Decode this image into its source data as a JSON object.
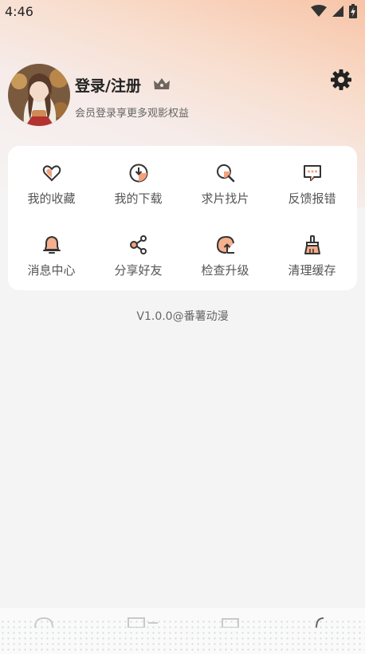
{
  "status_bar": {
    "time": "4:46"
  },
  "profile": {
    "login_label": "登录/注册",
    "subtitle": "会员登录享更多观影权益"
  },
  "menu": [
    {
      "label": "我的收藏",
      "icon": "heart-icon"
    },
    {
      "label": "我的下载",
      "icon": "download-icon"
    },
    {
      "label": "求片找片",
      "icon": "search-icon"
    },
    {
      "label": "反馈报错",
      "icon": "feedback-icon"
    },
    {
      "label": "消息中心",
      "icon": "bell-icon"
    },
    {
      "label": "分享好友",
      "icon": "share-icon"
    },
    {
      "label": "检查升级",
      "icon": "upgrade-icon"
    },
    {
      "label": "清理缓存",
      "icon": "clean-icon"
    }
  ],
  "version": "V1.0.0@番薯动漫",
  "colors": {
    "accent": "#f5a27a",
    "icon_stroke": "#333333"
  }
}
